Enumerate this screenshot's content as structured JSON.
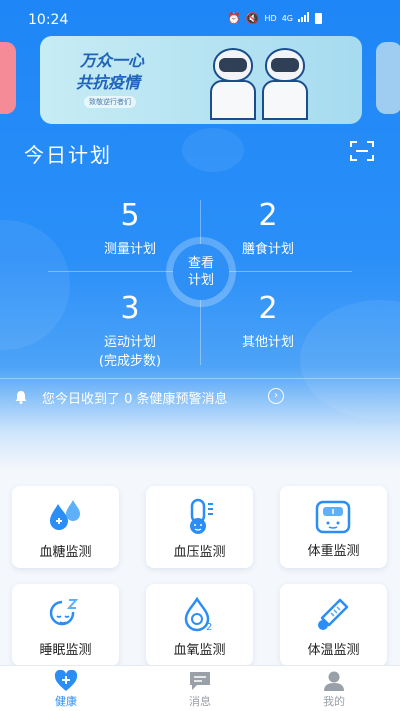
{
  "status_bar": {
    "time": "10:24",
    "hd": "HD",
    "network": "4G"
  },
  "banner": {
    "title_line1": "万众一心",
    "title_line2": "共抗疫情",
    "subtitle": "致敬逆行者们"
  },
  "plan_section": {
    "title": "今日计划",
    "cells": [
      {
        "count": "5",
        "label": "测量计划"
      },
      {
        "count": "2",
        "label": "膳食计划"
      },
      {
        "count": "3",
        "label": "运动计划",
        "sublabel": "(完成步数)"
      },
      {
        "count": "2",
        "label": "其他计划"
      }
    ],
    "view_button": {
      "line1": "查看",
      "line2": "计划"
    }
  },
  "alert": {
    "text": "您今日收到了 0 条健康预警消息"
  },
  "monitors": [
    {
      "label": "血糖监测",
      "icon": "blood-drop-icon"
    },
    {
      "label": "血压监测",
      "icon": "thermometer-face-icon"
    },
    {
      "label": "体重监测",
      "icon": "scale-icon"
    },
    {
      "label": "睡眠监测",
      "icon": "sleep-face-icon"
    },
    {
      "label": "血氧监测",
      "icon": "oxygen-drop-icon"
    },
    {
      "label": "体温监测",
      "icon": "thermometer-icon"
    }
  ],
  "tabbar": {
    "tabs": [
      {
        "label": "健康",
        "icon": "heart-plus-icon",
        "active": true
      },
      {
        "label": "消息",
        "icon": "message-icon",
        "active": false
      },
      {
        "label": "我的",
        "icon": "user-icon",
        "active": false
      }
    ]
  },
  "colors": {
    "primary": "#1e86f6",
    "accent": "#2b8ef7",
    "tab_inactive": "#9aa0a8"
  }
}
